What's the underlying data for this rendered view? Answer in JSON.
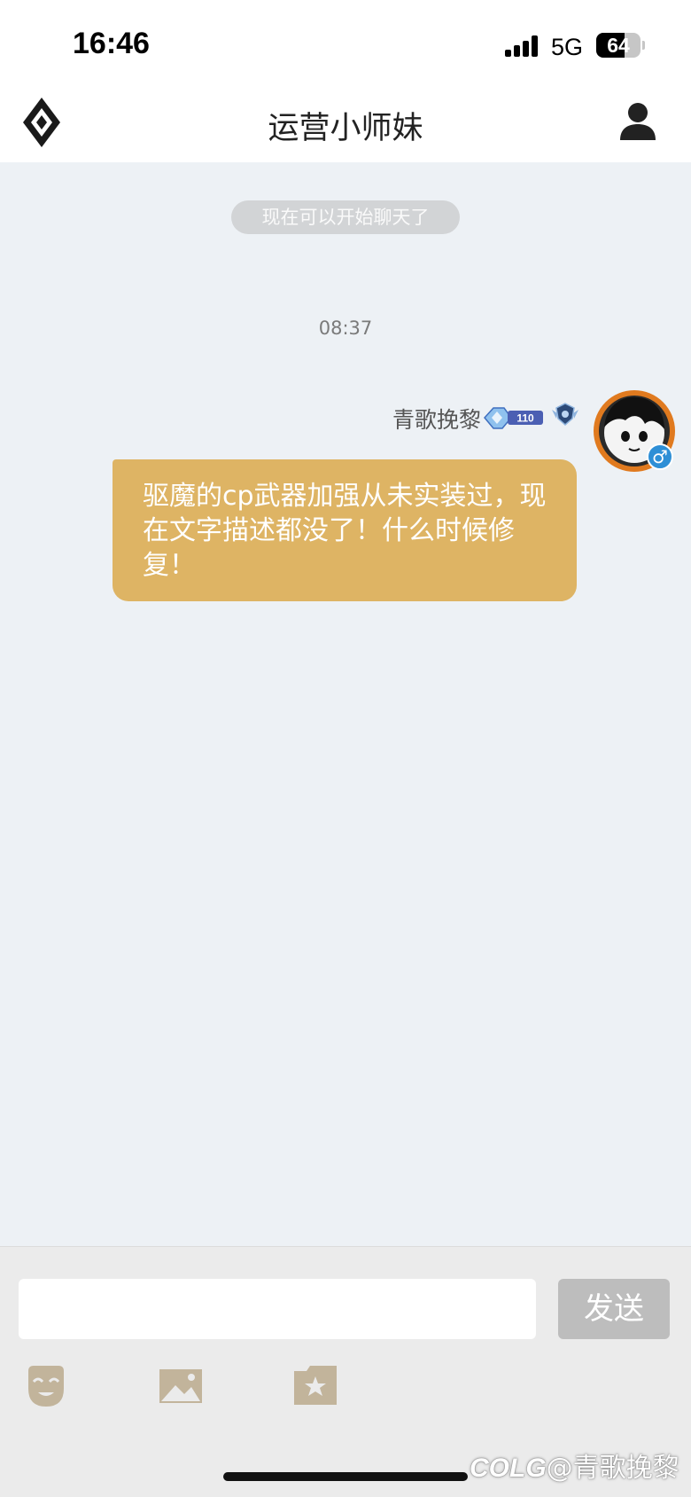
{
  "status_bar": {
    "time": "16:46",
    "network": "5G",
    "battery": "64",
    "battery_level": 0.64
  },
  "header": {
    "title": "运营小师妹",
    "logo_icon": "diamond-logo-icon",
    "profile_icon": "person-icon"
  },
  "chat": {
    "system_notice": "现在可以开始聊天了",
    "timestamp": "08:37",
    "messages": [
      {
        "sender": "青歌挽黎",
        "level": "110",
        "text": "驱魔的cp武器加强从未实装过，现在文字描述都没了！什么时候修复！",
        "bubble_color": "#deb464",
        "gender": "♂"
      }
    ]
  },
  "input_bar": {
    "placeholder": "",
    "send_label": "发送",
    "tools": [
      "emoji-icon",
      "image-icon",
      "gift-icon"
    ]
  },
  "watermark": {
    "brand": "COLG",
    "text": "@青歌挽黎"
  },
  "colors": {
    "accent_gold": "#deb464",
    "tool_icon": "#c2b49b",
    "background": "#edf1f5"
  }
}
